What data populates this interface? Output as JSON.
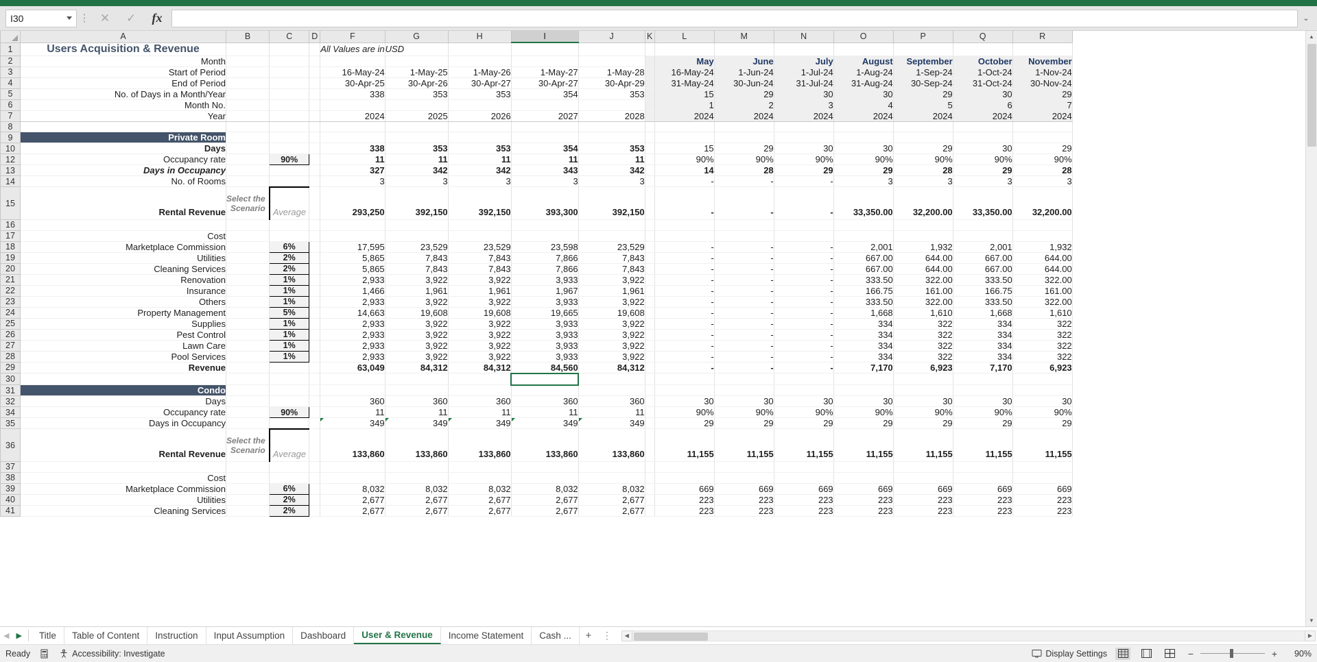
{
  "app": {
    "namebox_value": "I30",
    "formula_value": "",
    "icons": {
      "cancel": "cancel-icon",
      "confirm": "confirm-icon",
      "function": "fx-icon",
      "expand": "expand-formula-bar-icon"
    }
  },
  "columns": [
    "A",
    "B",
    "C",
    "D",
    "F",
    "G",
    "H",
    "I",
    "J",
    "K",
    "L",
    "M",
    "N",
    "O",
    "P",
    "Q",
    "R"
  ],
  "selected_column": "I",
  "row_numbers": [
    "1",
    "2",
    "3",
    "4",
    "5",
    "6",
    "7",
    "8",
    "9",
    "10",
    "12",
    "13",
    "14",
    "15",
    "16",
    "17",
    "18",
    "19",
    "20",
    "21",
    "22",
    "23",
    "24",
    "25",
    "26",
    "27",
    "28",
    "29",
    "30",
    "31",
    "32",
    "34",
    "35",
    "36",
    "37",
    "38",
    "39",
    "40",
    "41"
  ],
  "sheet": {
    "title": "Users Acquisition  & Revenue",
    "units_note_1": "All Values are in",
    "units_note_2": "USD",
    "row_labels": {
      "month": "Month",
      "start_of_period": "Start of Period",
      "end_of_period": "End of Period",
      "days_in_month_year": "No. of Days in a Month/Year",
      "month_no": "Month No.",
      "year": "Year",
      "days": "Days",
      "occupancy_rate": "Occupancy rate",
      "days_in_occupancy": "Days in Occupancy",
      "no_of_rooms": "No. of Rooms",
      "rental_revenue": "Rental Revenue",
      "cost": "Cost",
      "marketplace_commission": "Marketplace Commission",
      "utilities": "Utilities",
      "cleaning_services": "Cleaning Services",
      "renovation": "Renovation",
      "insurance": "Insurance",
      "others": "Others",
      "property_management": "Property Management",
      "supplies": "Supplies",
      "pest_control": "Pest Control",
      "lawn_care": "Lawn Care",
      "pool_services": "Pool Services",
      "revenue": "Revenue"
    },
    "section_private_room": "Private Room",
    "section_condo": "Condo",
    "scenario_label_line1": "Select the",
    "scenario_label_line2": "Scenario",
    "scenario_value": "Average",
    "annual": {
      "month_headers": [
        "",
        "",
        "",
        "",
        ""
      ],
      "start_of_period": [
        "16-May-24",
        "1-May-25",
        "1-May-26",
        "1-May-27",
        "1-May-28"
      ],
      "end_of_period": [
        "30-Apr-25",
        "30-Apr-26",
        "30-Apr-27",
        "30-Apr-27",
        "30-Apr-29"
      ],
      "days_in_period": [
        "338",
        "353",
        "353",
        "354",
        "353"
      ],
      "month_no": [
        "",
        "",
        "",
        "",
        ""
      ],
      "year": [
        "2024",
        "2025",
        "2026",
        "2027",
        "2028"
      ]
    },
    "monthly": {
      "month_headers": [
        "May",
        "June",
        "July",
        "August",
        "September",
        "October",
        "November"
      ],
      "start_of_period": [
        "16-May-24",
        "1-Jun-24",
        "1-Jul-24",
        "1-Aug-24",
        "1-Sep-24",
        "1-Oct-24",
        "1-Nov-24"
      ],
      "end_of_period": [
        "31-May-24",
        "30-Jun-24",
        "31-Jul-24",
        "31-Aug-24",
        "30-Sep-24",
        "31-Oct-24",
        "30-Nov-24"
      ],
      "days_in_period": [
        "15",
        "29",
        "30",
        "30",
        "29",
        "30",
        "29"
      ],
      "month_no": [
        "1",
        "2",
        "3",
        "4",
        "5",
        "6",
        "7"
      ],
      "year": [
        "2024",
        "2024",
        "2024",
        "2024",
        "2024",
        "2024",
        "2024"
      ]
    },
    "private_room": {
      "days_annual": [
        "338",
        "353",
        "353",
        "354",
        "353"
      ],
      "days_monthly": [
        "15",
        "29",
        "30",
        "30",
        "29",
        "30",
        "29"
      ],
      "occupancy_input": "90%",
      "occupancy_annual": [
        "11",
        "11",
        "11",
        "11",
        "11"
      ],
      "occupancy_monthly": [
        "90%",
        "90%",
        "90%",
        "90%",
        "90%",
        "90%",
        "90%"
      ],
      "days_in_occupancy_annual": [
        "327",
        "342",
        "342",
        "343",
        "342"
      ],
      "days_in_occupancy_monthly": [
        "14",
        "28",
        "29",
        "29",
        "28",
        "29",
        "28"
      ],
      "rooms_annual": [
        "3",
        "3",
        "3",
        "3",
        "3"
      ],
      "rooms_monthly": [
        "-",
        "-",
        "-",
        "3",
        "3",
        "3",
        "3"
      ],
      "rental_revenue_annual": [
        "293,250",
        "392,150",
        "392,150",
        "393,300",
        "392,150"
      ],
      "rental_revenue_monthly": [
        "-",
        "-",
        "-",
        "33,350.00",
        "32,200.00",
        "33,350.00",
        "32,200.00"
      ],
      "costs": [
        {
          "label": "Marketplace Commission",
          "pct": "6%",
          "annual": [
            "17,595",
            "23,529",
            "23,529",
            "23,598",
            "23,529"
          ],
          "monthly": [
            "-",
            "-",
            "-",
            "2,001",
            "1,932",
            "2,001",
            "1,932"
          ]
        },
        {
          "label": "Utilities",
          "pct": "2%",
          "annual": [
            "5,865",
            "7,843",
            "7,843",
            "7,866",
            "7,843"
          ],
          "monthly": [
            "-",
            "-",
            "-",
            "667.00",
            "644.00",
            "667.00",
            "644.00"
          ]
        },
        {
          "label": "Cleaning Services",
          "pct": "2%",
          "annual": [
            "5,865",
            "7,843",
            "7,843",
            "7,866",
            "7,843"
          ],
          "monthly": [
            "-",
            "-",
            "-",
            "667.00",
            "644.00",
            "667.00",
            "644.00"
          ]
        },
        {
          "label": "Renovation",
          "pct": "1%",
          "annual": [
            "2,933",
            "3,922",
            "3,922",
            "3,933",
            "3,922"
          ],
          "monthly": [
            "-",
            "-",
            "-",
            "333.50",
            "322.00",
            "333.50",
            "322.00"
          ]
        },
        {
          "label": "Insurance",
          "pct": "1%",
          "annual": [
            "1,466",
            "1,961",
            "1,961",
            "1,967",
            "1,961"
          ],
          "monthly": [
            "-",
            "-",
            "-",
            "166.75",
            "161.00",
            "166.75",
            "161.00"
          ]
        },
        {
          "label": "Others",
          "pct": "1%",
          "annual": [
            "2,933",
            "3,922",
            "3,922",
            "3,933",
            "3,922"
          ],
          "monthly": [
            "-",
            "-",
            "-",
            "333.50",
            "322.00",
            "333.50",
            "322.00"
          ]
        },
        {
          "label": "Property Management",
          "pct": "5%",
          "annual": [
            "14,663",
            "19,608",
            "19,608",
            "19,665",
            "19,608"
          ],
          "monthly": [
            "-",
            "-",
            "-",
            "1,668",
            "1,610",
            "1,668",
            "1,610"
          ]
        },
        {
          "label": "Supplies",
          "pct": "1%",
          "annual": [
            "2,933",
            "3,922",
            "3,922",
            "3,933",
            "3,922"
          ],
          "monthly": [
            "-",
            "-",
            "-",
            "334",
            "322",
            "334",
            "322"
          ]
        },
        {
          "label": "Pest Control",
          "pct": "1%",
          "annual": [
            "2,933",
            "3,922",
            "3,922",
            "3,933",
            "3,922"
          ],
          "monthly": [
            "-",
            "-",
            "-",
            "334",
            "322",
            "334",
            "322"
          ]
        },
        {
          "label": "Lawn Care",
          "pct": "1%",
          "annual": [
            "2,933",
            "3,922",
            "3,922",
            "3,933",
            "3,922"
          ],
          "monthly": [
            "-",
            "-",
            "-",
            "334",
            "322",
            "334",
            "322"
          ]
        },
        {
          "label": "Pool Services",
          "pct": "1%",
          "annual": [
            "2,933",
            "3,922",
            "3,922",
            "3,933",
            "3,922"
          ],
          "monthly": [
            "-",
            "-",
            "-",
            "334",
            "322",
            "334",
            "322"
          ]
        }
      ],
      "revenue_annual": [
        "63,049",
        "84,312",
        "84,312",
        "84,560",
        "84,312"
      ],
      "revenue_monthly": [
        "-",
        "-",
        "-",
        "7,170",
        "6,923",
        "7,170",
        "6,923"
      ]
    },
    "condo": {
      "days_annual": [
        "360",
        "360",
        "360",
        "360",
        "360"
      ],
      "days_monthly": [
        "30",
        "30",
        "30",
        "30",
        "30",
        "30",
        "30"
      ],
      "occupancy_input": "90%",
      "occupancy_annual": [
        "11",
        "11",
        "11",
        "11",
        "11"
      ],
      "occupancy_monthly": [
        "90%",
        "90%",
        "90%",
        "90%",
        "90%",
        "90%",
        "90%"
      ],
      "days_in_occupancy_annual": [
        "349",
        "349",
        "349",
        "349",
        "349"
      ],
      "days_in_occupancy_monthly": [
        "29",
        "29",
        "29",
        "29",
        "29",
        "29",
        "29"
      ],
      "rental_revenue_annual": [
        "133,860",
        "133,860",
        "133,860",
        "133,860",
        "133,860"
      ],
      "rental_revenue_monthly": [
        "11,155",
        "11,155",
        "11,155",
        "11,155",
        "11,155",
        "11,155",
        "11,155"
      ],
      "costs": [
        {
          "label": "Marketplace Commission",
          "pct": "6%",
          "annual": [
            "8,032",
            "8,032",
            "8,032",
            "8,032",
            "8,032"
          ],
          "monthly": [
            "669",
            "669",
            "669",
            "669",
            "669",
            "669",
            "669"
          ]
        },
        {
          "label": "Utilities",
          "pct": "2%",
          "annual": [
            "2,677",
            "2,677",
            "2,677",
            "2,677",
            "2,677"
          ],
          "monthly": [
            "223",
            "223",
            "223",
            "223",
            "223",
            "223",
            "223"
          ]
        },
        {
          "label": "Cleaning Services",
          "pct": "2%",
          "annual": [
            "2,677",
            "2,677",
            "2,677",
            "2,677",
            "2,677"
          ],
          "monthly": [
            "223",
            "223",
            "223",
            "223",
            "223",
            "223",
            "223"
          ]
        }
      ]
    }
  },
  "tabs": {
    "items": [
      {
        "label": "Title",
        "active": false
      },
      {
        "label": "Table of Content",
        "active": false
      },
      {
        "label": "Instruction",
        "active": false
      },
      {
        "label": "Input Assumption",
        "active": false
      },
      {
        "label": "Dashboard",
        "active": false
      },
      {
        "label": "User & Revenue",
        "active": true
      },
      {
        "label": "Income Statement",
        "active": false
      },
      {
        "label": "Cash ...",
        "active": false
      }
    ],
    "add_label": "+",
    "more_label": "⋮"
  },
  "statusbar": {
    "ready": "Ready",
    "accessibility": "Accessibility: Investigate",
    "display_settings": "Display Settings",
    "zoom": "90%"
  }
}
